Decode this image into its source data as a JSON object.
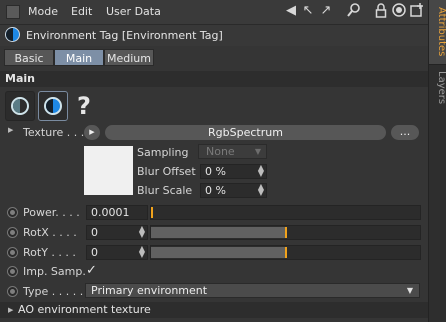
{
  "menu": {
    "items": [
      "Mode",
      "Edit",
      "User Data"
    ]
  },
  "toolbar": {
    "icons": [
      "arrow-left-icon",
      "arrow-up-icon",
      "search-icon",
      "lock-icon",
      "target-icon",
      "new-panel-icon"
    ]
  },
  "side_tabs": {
    "attributes": "Attributes",
    "layers": "Layers"
  },
  "header": {
    "title": "Environment Tag [Environment Tag]"
  },
  "mode_tabs": [
    {
      "label": "Basic",
      "active": false
    },
    {
      "label": "Main",
      "active": true
    },
    {
      "label": "Medium",
      "active": false
    }
  ],
  "section": {
    "main_label": "Main",
    "ao_label": "AO environment texture"
  },
  "texture": {
    "label": "Texture . . .",
    "button_label": "RgbSpectrum",
    "more_label": "...",
    "sampling_label": "Sampling",
    "sampling_value": "None",
    "blur_offset_label": "Blur Offset",
    "blur_offset_value": "0 %",
    "blur_scale_label": "Blur Scale",
    "blur_scale_value": "0 %"
  },
  "params": {
    "power_label": "Power. . . .",
    "power_value": "0.0001",
    "power_level": 0.0,
    "rotx_label": "RotX . . . .",
    "rotx_value": "0",
    "rotx_level": 0.5,
    "roty_label": "RotY . . . .",
    "roty_value": "0",
    "roty_level": 0.5,
    "imp_label": "Imp. Samp.",
    "imp_checked": "✓",
    "type_label": "Type . . . . .",
    "type_value": "Primary environment"
  },
  "colors": {
    "accent": "#f0a21c",
    "active_tab": "#7d8fa6",
    "tag_blue": "#1e88e5"
  }
}
